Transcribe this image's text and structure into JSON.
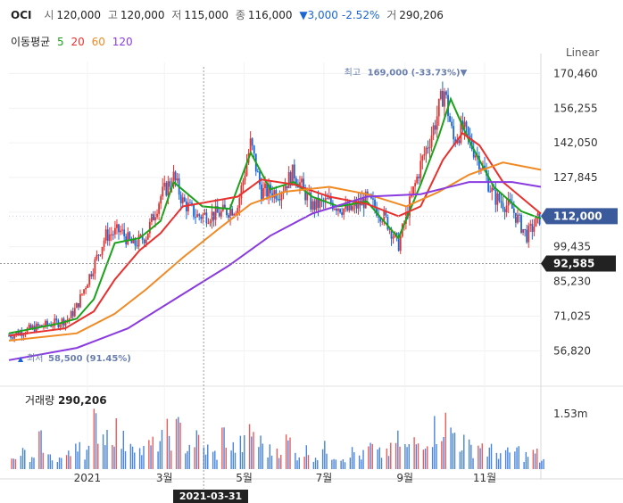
{
  "header": {
    "ticker": "OCI",
    "open_label": "시",
    "open": "120,000",
    "high_label": "고",
    "high": "120,000",
    "low_label": "저",
    "low": "115,000",
    "close_label": "종",
    "close": "116,000",
    "change": "▼3,000",
    "change_pct": "-2.52%",
    "volume_label": "거",
    "volume": "290,206"
  },
  "moving_average": {
    "label": "이동평균",
    "periods": [
      {
        "value": "5",
        "color": "#1aa31a"
      },
      {
        "value": "20",
        "color": "#e8312f"
      },
      {
        "value": "60",
        "color": "#f08a24"
      },
      {
        "value": "120",
        "color": "#8a3be0"
      }
    ]
  },
  "scale_mode": "Linear",
  "colors": {
    "up": "#e8312f",
    "down": "#1b66d2",
    "current_price_tag": "#3a5a9c",
    "crosshair_tag": "#222222"
  },
  "chart_data": {
    "type": "candlestick",
    "y_ticks": [
      170460,
      156255,
      142050,
      127845,
      113640,
      99435,
      85230,
      71025,
      56820
    ],
    "y_tick_labels": [
      "170,460",
      "156,255",
      "142,050",
      "127,845",
      "99,435",
      "85,230",
      "71,025",
      "56,820"
    ],
    "ylim": [
      50000,
      175000
    ],
    "x_ticks": [
      "2021",
      "3월",
      "5월",
      "7월",
      "9월",
      "11월"
    ],
    "x_tick_dates": [
      "2021-01-01",
      "2021-03-01",
      "2021-05-01",
      "2021-07-01",
      "2021-09-01",
      "2021-11-01"
    ],
    "xlim": [
      "2020-11-02",
      "2021-12-14"
    ],
    "price_points": [
      [
        "2020-11-02",
        63000
      ],
      [
        "2020-11-20",
        66000
      ],
      [
        "2020-12-10",
        68500
      ],
      [
        "2020-12-18",
        70000
      ],
      [
        "2020-12-24",
        75000
      ],
      [
        "2021-01-06",
        92000
      ],
      [
        "2021-01-15",
        104000
      ],
      [
        "2021-01-26",
        106000
      ],
      [
        "2021-02-05",
        100000
      ],
      [
        "2021-02-15",
        104000
      ],
      [
        "2021-02-26",
        120000
      ],
      [
        "2021-03-08",
        128000
      ],
      [
        "2021-03-15",
        118000
      ],
      [
        "2021-03-26",
        112000
      ],
      [
        "2021-04-12",
        113000
      ],
      [
        "2021-04-26",
        116000
      ],
      [
        "2021-05-06",
        142000
      ],
      [
        "2021-05-14",
        122000
      ],
      [
        "2021-05-28",
        122000
      ],
      [
        "2021-06-08",
        130000
      ],
      [
        "2021-06-22",
        116000
      ],
      [
        "2021-07-05",
        118000
      ],
      [
        "2021-07-20",
        114000
      ],
      [
        "2021-08-03",
        119000
      ],
      [
        "2021-08-17",
        111000
      ],
      [
        "2021-08-27",
        100000
      ],
      [
        "2021-09-02",
        112000
      ],
      [
        "2021-09-13",
        133000
      ],
      [
        "2021-09-24",
        150000
      ],
      [
        "2021-10-01",
        164000
      ],
      [
        "2021-10-08",
        143000
      ],
      [
        "2021-10-15",
        148000
      ],
      [
        "2021-10-28",
        135000
      ],
      [
        "2021-11-08",
        120000
      ],
      [
        "2021-11-22",
        115000
      ],
      [
        "2021-12-03",
        104000
      ],
      [
        "2021-12-14",
        112000
      ]
    ],
    "ma_series": [
      {
        "name": "5",
        "color": "#1aa31a",
        "points": [
          [
            "2020-11-02",
            64000
          ],
          [
            "2020-12-10",
            68000
          ],
          [
            "2020-12-24",
            70000
          ],
          [
            "2021-01-06",
            78000
          ],
          [
            "2021-01-22",
            101000
          ],
          [
            "2021-02-10",
            103000
          ],
          [
            "2021-02-26",
            110000
          ],
          [
            "2021-03-08",
            126000
          ],
          [
            "2021-03-30",
            116000
          ],
          [
            "2021-04-20",
            115000
          ],
          [
            "2021-05-06",
            138000
          ],
          [
            "2021-05-21",
            123000
          ],
          [
            "2021-06-08",
            126000
          ],
          [
            "2021-06-22",
            120000
          ],
          [
            "2021-07-12",
            116000
          ],
          [
            "2021-08-03",
            118000
          ],
          [
            "2021-08-27",
            103000
          ],
          [
            "2021-09-13",
            125000
          ],
          [
            "2021-09-27",
            145000
          ],
          [
            "2021-10-06",
            160000
          ],
          [
            "2021-10-20",
            143000
          ],
          [
            "2021-11-08",
            124000
          ],
          [
            "2021-11-29",
            114000
          ],
          [
            "2021-12-14",
            111000
          ]
        ]
      },
      {
        "name": "20",
        "color": "#e8312f",
        "points": [
          [
            "2020-11-02",
            63000
          ],
          [
            "2020-12-15",
            66000
          ],
          [
            "2021-01-06",
            73000
          ],
          [
            "2021-01-22",
            86000
          ],
          [
            "2021-02-10",
            98000
          ],
          [
            "2021-02-26",
            105000
          ],
          [
            "2021-03-15",
            116000
          ],
          [
            "2021-04-05",
            118000
          ],
          [
            "2021-04-26",
            120000
          ],
          [
            "2021-05-14",
            127000
          ],
          [
            "2021-06-08",
            125000
          ],
          [
            "2021-07-05",
            120000
          ],
          [
            "2021-08-03",
            117000
          ],
          [
            "2021-08-27",
            112000
          ],
          [
            "2021-09-13",
            116000
          ],
          [
            "2021-09-30",
            135000
          ],
          [
            "2021-10-15",
            146000
          ],
          [
            "2021-10-28",
            141000
          ],
          [
            "2021-11-15",
            126000
          ],
          [
            "2021-12-14",
            113000
          ]
        ]
      },
      {
        "name": "60",
        "color": "#f08a24",
        "points": [
          [
            "2020-11-02",
            61000
          ],
          [
            "2020-12-24",
            64000
          ],
          [
            "2021-01-22",
            72000
          ],
          [
            "2021-02-15",
            82000
          ],
          [
            "2021-03-15",
            95000
          ],
          [
            "2021-04-12",
            107000
          ],
          [
            "2021-05-06",
            117000
          ],
          [
            "2021-06-01",
            122000
          ],
          [
            "2021-07-05",
            124000
          ],
          [
            "2021-08-03",
            121000
          ],
          [
            "2021-09-02",
            116000
          ],
          [
            "2021-09-27",
            122000
          ],
          [
            "2021-10-20",
            129000
          ],
          [
            "2021-11-15",
            134000
          ],
          [
            "2021-12-14",
            131000
          ]
        ]
      },
      {
        "name": "120",
        "color": "#8a3be0",
        "points": [
          [
            "2020-11-02",
            53000
          ],
          [
            "2020-12-24",
            58000
          ],
          [
            "2021-02-01",
            66000
          ],
          [
            "2021-03-15",
            80000
          ],
          [
            "2021-04-20",
            92000
          ],
          [
            "2021-05-21",
            104000
          ],
          [
            "2021-06-22",
            113000
          ],
          [
            "2021-08-03",
            120000
          ],
          [
            "2021-09-13",
            121000
          ],
          [
            "2021-10-20",
            126000
          ],
          [
            "2021-11-22",
            126000
          ],
          [
            "2021-12-14",
            124000
          ]
        ]
      }
    ],
    "high_marker": {
      "date": "2021-10-01",
      "value": 169000,
      "label": "최고",
      "text": "169,000 (-33.73%)▼"
    },
    "low_marker": {
      "date": "2020-11-02",
      "value": 58500,
      "label": "최저",
      "text": "58,500 (91.45%)"
    },
    "current_price": {
      "value": 112000,
      "label": "112,000"
    },
    "crosshair": {
      "price": 92585,
      "price_label": "92,585",
      "date": "2021-03-31",
      "date_label": "2021-03-31"
    },
    "volume": {
      "label": "거래량",
      "last": "290,206",
      "y_tick_label": "1.53m",
      "ymax": 1530000,
      "bars": [
        [
          "2020-11-05",
          280000
        ],
        [
          "2020-11-12",
          520000
        ],
        [
          "2020-11-19",
          310000
        ],
        [
          "2020-11-26",
          900000
        ],
        [
          "2020-12-03",
          400000
        ],
        [
          "2020-12-10",
          360000
        ],
        [
          "2020-12-17",
          450000
        ],
        [
          "2020-12-24",
          980000
        ],
        [
          "2020-12-31",
          600000
        ],
        [
          "2021-01-07",
          1450000
        ],
        [
          "2021-01-14",
          1200000
        ],
        [
          "2021-01-21",
          1300000
        ],
        [
          "2021-01-28",
          900000
        ],
        [
          "2021-02-04",
          1050000
        ],
        [
          "2021-02-11",
          600000
        ],
        [
          "2021-02-18",
          750000
        ],
        [
          "2021-02-25",
          950000
        ],
        [
          "2021-03-04",
          1150000
        ],
        [
          "2021-03-11",
          1250000
        ],
        [
          "2021-03-18",
          800000
        ],
        [
          "2021-03-25",
          950000
        ],
        [
          "2021-04-01",
          650000
        ],
        [
          "2021-04-08",
          500000
        ],
        [
          "2021-04-15",
          1100000
        ],
        [
          "2021-04-22",
          700000
        ],
        [
          "2021-04-29",
          800000
        ],
        [
          "2021-05-06",
          1200000
        ],
        [
          "2021-05-13",
          850000
        ],
        [
          "2021-05-20",
          600000
        ],
        [
          "2021-05-27",
          700000
        ],
        [
          "2021-06-03",
          880000
        ],
        [
          "2021-06-10",
          500000
        ],
        [
          "2021-06-17",
          600000
        ],
        [
          "2021-06-24",
          450000
        ],
        [
          "2021-07-01",
          650000
        ],
        [
          "2021-07-08",
          500000
        ],
        [
          "2021-07-15",
          400000
        ],
        [
          "2021-07-22",
          550000
        ],
        [
          "2021-07-29",
          450000
        ],
        [
          "2021-08-05",
          700000
        ],
        [
          "2021-08-12",
          500000
        ],
        [
          "2021-08-19",
          600000
        ],
        [
          "2021-08-26",
          900000
        ],
        [
          "2021-09-02",
          700000
        ],
        [
          "2021-09-09",
          850000
        ],
        [
          "2021-09-16",
          1100000
        ],
        [
          "2021-09-23",
          1300000
        ],
        [
          "2021-09-30",
          1500000
        ],
        [
          "2021-10-07",
          1200000
        ],
        [
          "2021-10-14",
          900000
        ],
        [
          "2021-10-21",
          700000
        ],
        [
          "2021-10-28",
          800000
        ],
        [
          "2021-11-04",
          600000
        ],
        [
          "2021-11-11",
          550000
        ],
        [
          "2021-11-18",
          500000
        ],
        [
          "2021-11-25",
          600000
        ],
        [
          "2021-12-02",
          450000
        ],
        [
          "2021-12-09",
          500000
        ],
        [
          "2021-12-14",
          290206
        ]
      ]
    }
  }
}
